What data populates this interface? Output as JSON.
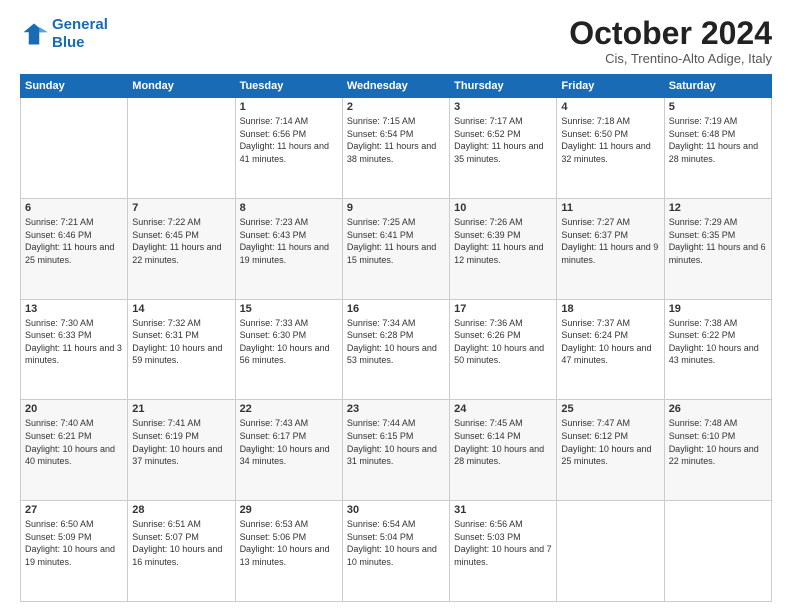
{
  "header": {
    "logo_line1": "General",
    "logo_line2": "Blue",
    "month_title": "October 2024",
    "subtitle": "Cis, Trentino-Alto Adige, Italy"
  },
  "days_of_week": [
    "Sunday",
    "Monday",
    "Tuesday",
    "Wednesday",
    "Thursday",
    "Friday",
    "Saturday"
  ],
  "weeks": [
    [
      {
        "day": "",
        "info": ""
      },
      {
        "day": "",
        "info": ""
      },
      {
        "day": "1",
        "info": "Sunrise: 7:14 AM\nSunset: 6:56 PM\nDaylight: 11 hours and 41 minutes."
      },
      {
        "day": "2",
        "info": "Sunrise: 7:15 AM\nSunset: 6:54 PM\nDaylight: 11 hours and 38 minutes."
      },
      {
        "day": "3",
        "info": "Sunrise: 7:17 AM\nSunset: 6:52 PM\nDaylight: 11 hours and 35 minutes."
      },
      {
        "day": "4",
        "info": "Sunrise: 7:18 AM\nSunset: 6:50 PM\nDaylight: 11 hours and 32 minutes."
      },
      {
        "day": "5",
        "info": "Sunrise: 7:19 AM\nSunset: 6:48 PM\nDaylight: 11 hours and 28 minutes."
      }
    ],
    [
      {
        "day": "6",
        "info": "Sunrise: 7:21 AM\nSunset: 6:46 PM\nDaylight: 11 hours and 25 minutes."
      },
      {
        "day": "7",
        "info": "Sunrise: 7:22 AM\nSunset: 6:45 PM\nDaylight: 11 hours and 22 minutes."
      },
      {
        "day": "8",
        "info": "Sunrise: 7:23 AM\nSunset: 6:43 PM\nDaylight: 11 hours and 19 minutes."
      },
      {
        "day": "9",
        "info": "Sunrise: 7:25 AM\nSunset: 6:41 PM\nDaylight: 11 hours and 15 minutes."
      },
      {
        "day": "10",
        "info": "Sunrise: 7:26 AM\nSunset: 6:39 PM\nDaylight: 11 hours and 12 minutes."
      },
      {
        "day": "11",
        "info": "Sunrise: 7:27 AM\nSunset: 6:37 PM\nDaylight: 11 hours and 9 minutes."
      },
      {
        "day": "12",
        "info": "Sunrise: 7:29 AM\nSunset: 6:35 PM\nDaylight: 11 hours and 6 minutes."
      }
    ],
    [
      {
        "day": "13",
        "info": "Sunrise: 7:30 AM\nSunset: 6:33 PM\nDaylight: 11 hours and 3 minutes."
      },
      {
        "day": "14",
        "info": "Sunrise: 7:32 AM\nSunset: 6:31 PM\nDaylight: 10 hours and 59 minutes."
      },
      {
        "day": "15",
        "info": "Sunrise: 7:33 AM\nSunset: 6:30 PM\nDaylight: 10 hours and 56 minutes."
      },
      {
        "day": "16",
        "info": "Sunrise: 7:34 AM\nSunset: 6:28 PM\nDaylight: 10 hours and 53 minutes."
      },
      {
        "day": "17",
        "info": "Sunrise: 7:36 AM\nSunset: 6:26 PM\nDaylight: 10 hours and 50 minutes."
      },
      {
        "day": "18",
        "info": "Sunrise: 7:37 AM\nSunset: 6:24 PM\nDaylight: 10 hours and 47 minutes."
      },
      {
        "day": "19",
        "info": "Sunrise: 7:38 AM\nSunset: 6:22 PM\nDaylight: 10 hours and 43 minutes."
      }
    ],
    [
      {
        "day": "20",
        "info": "Sunrise: 7:40 AM\nSunset: 6:21 PM\nDaylight: 10 hours and 40 minutes."
      },
      {
        "day": "21",
        "info": "Sunrise: 7:41 AM\nSunset: 6:19 PM\nDaylight: 10 hours and 37 minutes."
      },
      {
        "day": "22",
        "info": "Sunrise: 7:43 AM\nSunset: 6:17 PM\nDaylight: 10 hours and 34 minutes."
      },
      {
        "day": "23",
        "info": "Sunrise: 7:44 AM\nSunset: 6:15 PM\nDaylight: 10 hours and 31 minutes."
      },
      {
        "day": "24",
        "info": "Sunrise: 7:45 AM\nSunset: 6:14 PM\nDaylight: 10 hours and 28 minutes."
      },
      {
        "day": "25",
        "info": "Sunrise: 7:47 AM\nSunset: 6:12 PM\nDaylight: 10 hours and 25 minutes."
      },
      {
        "day": "26",
        "info": "Sunrise: 7:48 AM\nSunset: 6:10 PM\nDaylight: 10 hours and 22 minutes."
      }
    ],
    [
      {
        "day": "27",
        "info": "Sunrise: 6:50 AM\nSunset: 5:09 PM\nDaylight: 10 hours and 19 minutes."
      },
      {
        "day": "28",
        "info": "Sunrise: 6:51 AM\nSunset: 5:07 PM\nDaylight: 10 hours and 16 minutes."
      },
      {
        "day": "29",
        "info": "Sunrise: 6:53 AM\nSunset: 5:06 PM\nDaylight: 10 hours and 13 minutes."
      },
      {
        "day": "30",
        "info": "Sunrise: 6:54 AM\nSunset: 5:04 PM\nDaylight: 10 hours and 10 minutes."
      },
      {
        "day": "31",
        "info": "Sunrise: 6:56 AM\nSunset: 5:03 PM\nDaylight: 10 hours and 7 minutes."
      },
      {
        "day": "",
        "info": ""
      },
      {
        "day": "",
        "info": ""
      }
    ]
  ]
}
